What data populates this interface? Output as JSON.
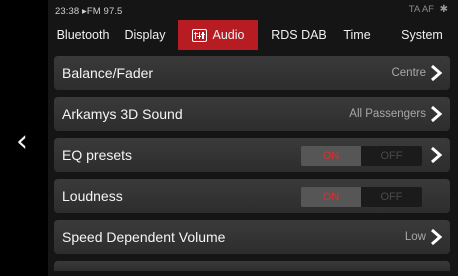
{
  "status": {
    "time": "23:38",
    "source": "▸FM 97.5",
    "ta": "TA",
    "af": "AF"
  },
  "tabs": [
    {
      "label": "Bluetooth",
      "active": false
    },
    {
      "label": "Display",
      "active": false
    },
    {
      "label": "Audio",
      "active": true,
      "icon": "equalizer-icon"
    },
    {
      "label": "RDS DAB",
      "active": false
    },
    {
      "label": "Time",
      "active": false
    },
    {
      "label": "System",
      "active": false
    }
  ],
  "settings": [
    {
      "label": "Balance/Fader",
      "value": "Centre",
      "type": "link"
    },
    {
      "label": "Arkamys 3D Sound",
      "value": "All Passengers",
      "type": "link"
    },
    {
      "label": "EQ presets",
      "on_label": "ON",
      "off_label": "OFF",
      "state": "ON",
      "type": "toggle-link"
    },
    {
      "label": "Loudness",
      "on_label": "ON",
      "off_label": "OFF",
      "state": "ON",
      "type": "toggle"
    },
    {
      "label": "Speed Dependent Volume",
      "value": "Low",
      "type": "link"
    }
  ],
  "colors": {
    "accent": "#b71c22",
    "on_text": "#e02d2d"
  }
}
